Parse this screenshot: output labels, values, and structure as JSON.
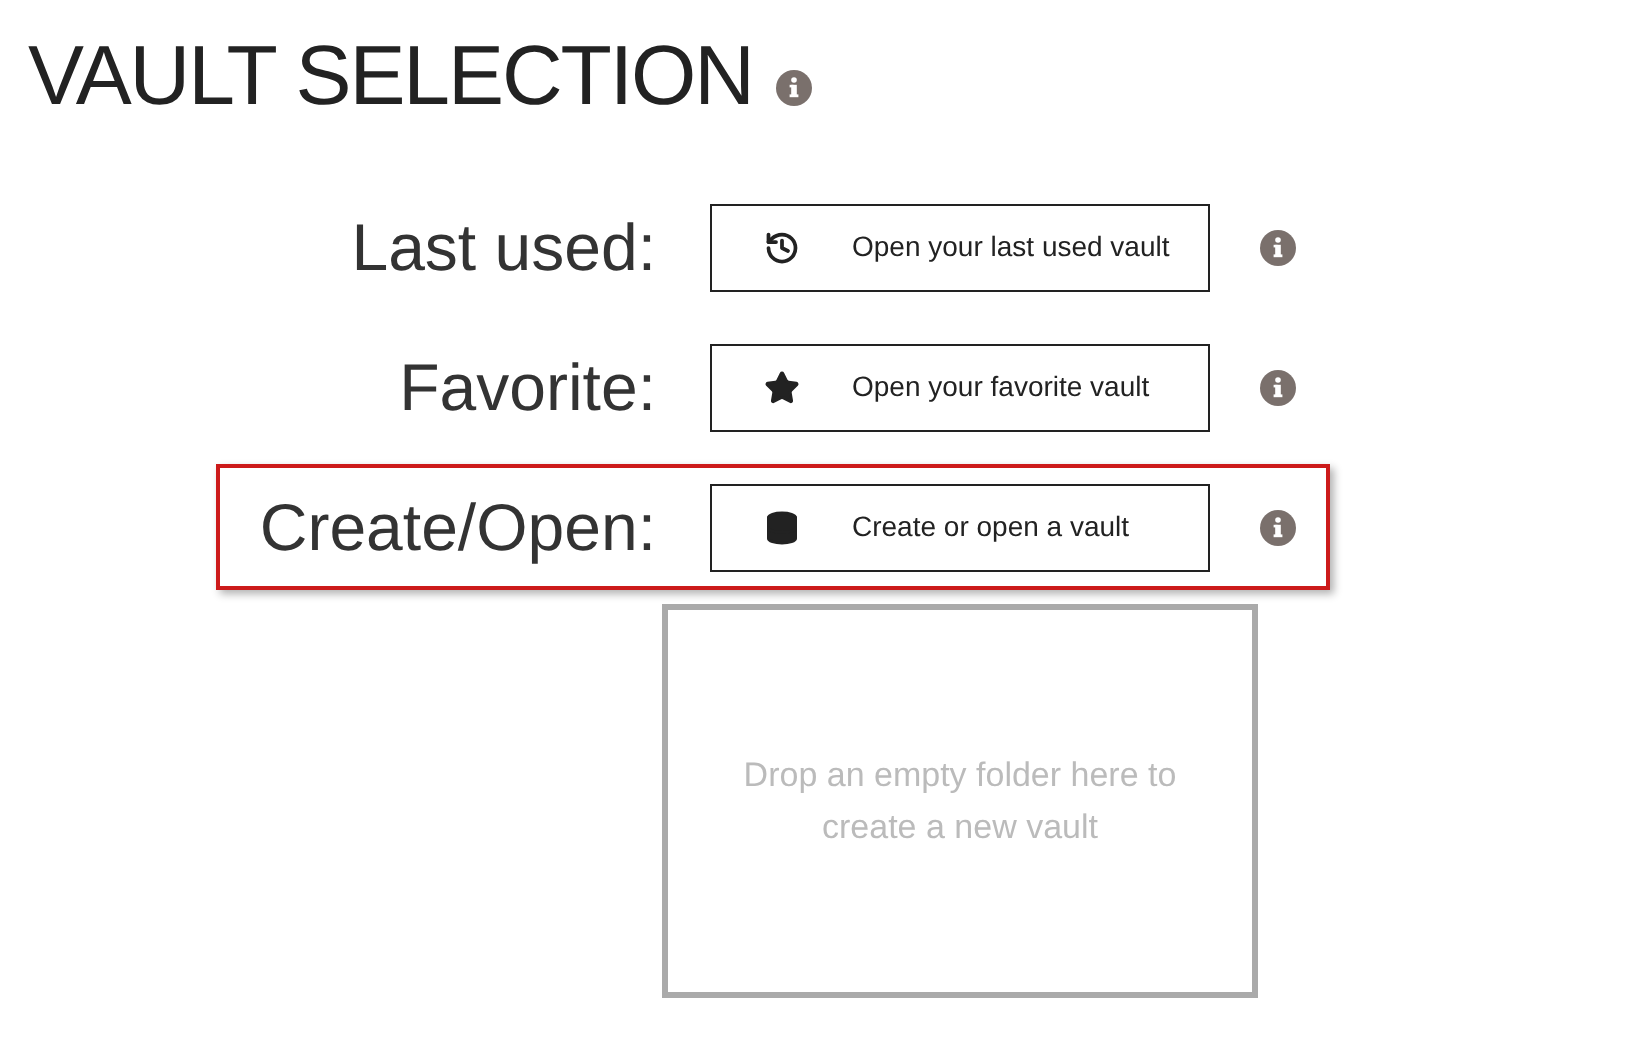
{
  "title": "VAULT SELECTION",
  "rows": [
    {
      "label": "Last used:",
      "kind": "history",
      "button": "Open your last used vault",
      "highlighted": false
    },
    {
      "label": "Favorite:",
      "kind": "star",
      "button": "Open your favorite vault",
      "highlighted": false
    },
    {
      "label": "Create/Open:",
      "kind": "database",
      "button": "Create or open a vault",
      "highlighted": true
    }
  ],
  "drop_zone": {
    "text": "Drop an empty folder here to create a new vault"
  }
}
